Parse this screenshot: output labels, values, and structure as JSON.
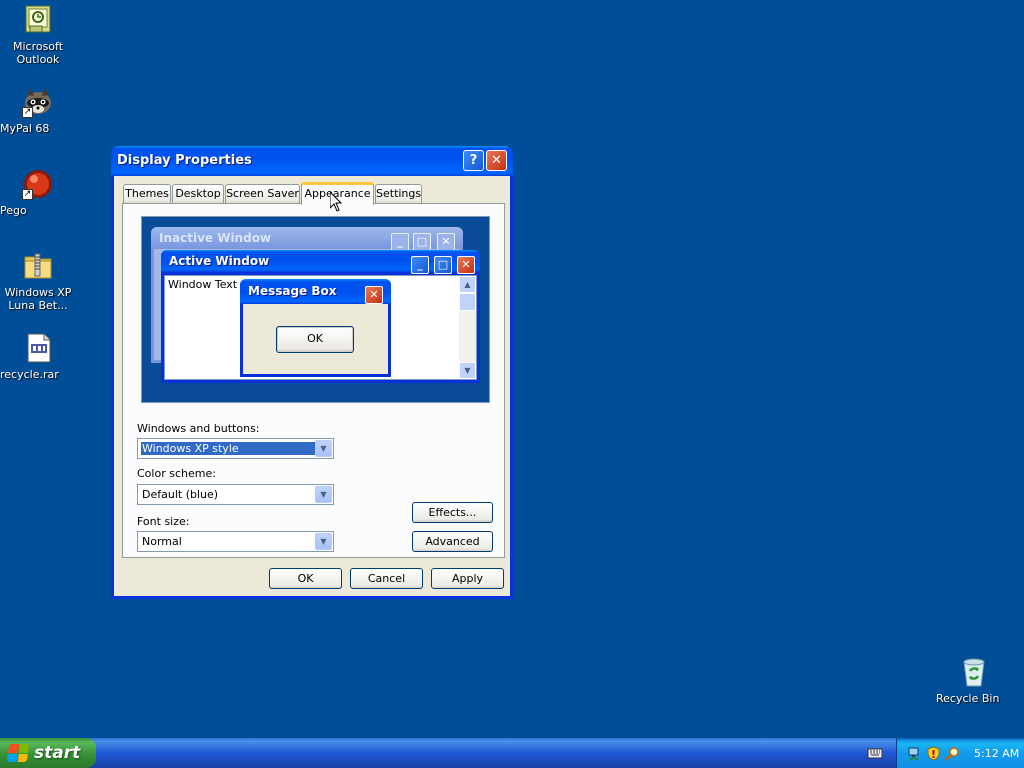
{
  "desktop": {
    "icons": [
      {
        "label": "Microsoft Outlook",
        "icon": "outlook-icon"
      },
      {
        "label": "MyPal 68",
        "icon": "mypal-raccoon-icon"
      },
      {
        "label": "Pego",
        "icon": "pego-red-ball-icon"
      },
      {
        "label": "Windows XP Luna Bet...",
        "icon": "zip-folder-icon"
      },
      {
        "label": "recycle.rar",
        "icon": "rar-archive-icon"
      },
      {
        "label": "Recycle Bin",
        "icon": "recycle-bin-icon"
      }
    ],
    "background_color": "#004e98"
  },
  "dialog": {
    "title": "Display Properties",
    "help_glyph": "?",
    "close_glyph": "✕",
    "tabs": [
      {
        "label": "Themes",
        "active": false
      },
      {
        "label": "Desktop",
        "active": false
      },
      {
        "label": "Screen Saver",
        "active": false
      },
      {
        "label": "Appearance",
        "active": true
      },
      {
        "label": "Settings",
        "active": false
      }
    ],
    "preview": {
      "inactive_title": "Inactive Window",
      "active_title": "Active Window",
      "window_text": "Window Text",
      "message_box_title": "Message Box",
      "message_ok": "OK"
    },
    "windows_and_buttons": {
      "label": "Windows and buttons:",
      "value": "Windows XP style"
    },
    "color_scheme": {
      "label": "Color scheme:",
      "value": "Default (blue)"
    },
    "font_size": {
      "label": "Font size:",
      "value": "Normal"
    },
    "effects_label": "Effects...",
    "advanced_label": "Advanced",
    "ok_label": "OK",
    "cancel_label": "Cancel",
    "apply_label": "Apply"
  },
  "taskbar": {
    "start_label": "start",
    "clock": "5:12 AM",
    "tray_icons": [
      "network-icon",
      "security-shield-icon",
      "search-icon"
    ],
    "keyboard_indicator": "keyboard-icon"
  },
  "colors": {
    "title_blue": "#0050ee",
    "dialog_bg": "#ece9d8",
    "close_red": "#c2300f",
    "start_green": "#379137",
    "active_tab_accent": "#ffc73c"
  }
}
